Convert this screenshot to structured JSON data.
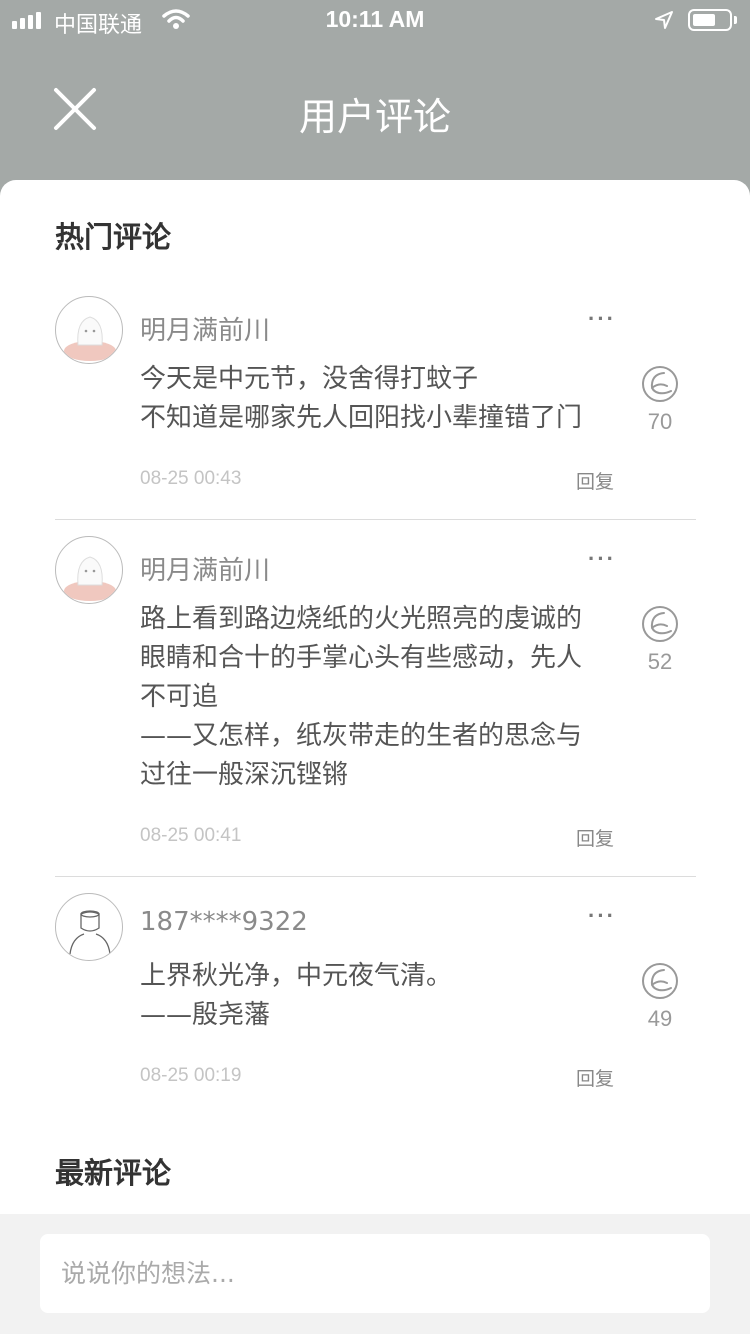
{
  "status_bar": {
    "carrier": "中国联通",
    "time": "10:11 AM",
    "icons": [
      "signal-icon",
      "wifi-icon",
      "location-arrow-icon",
      "battery-icon"
    ]
  },
  "nav": {
    "title": "用户评论",
    "close_icon": "close-icon"
  },
  "sections": {
    "hot_title": "热门评论",
    "latest_title": "最新评论"
  },
  "comments": [
    {
      "username": "明月满前川",
      "lines": [
        "今天是中元节，没舍得打蚊子",
        "不知道是哪家先人回阳找小辈撞错了门"
      ],
      "likes": "70",
      "time": "08-25 00:43",
      "reply": "回复",
      "more": "···"
    },
    {
      "username": "明月满前川",
      "lines": [
        "路上看到路边烧纸的火光照亮的虔诚的",
        "眼睛和合十的手掌心头有些感动，先人",
        "不可追",
        "——又怎样，纸灰带走的生者的思念与",
        "过往一般深沉铿锵"
      ],
      "likes": "52",
      "time": "08-25 00:41",
      "reply": "回复",
      "more": "···"
    },
    {
      "username": "187****9322",
      "lines": [
        "上界秋光净，中元夜气清。",
        "——殷尧藩"
      ],
      "likes": "49",
      "time": "08-25 00:19",
      "reply": "回复",
      "more": "···"
    }
  ],
  "input": {
    "placeholder": "说说你的想法..."
  },
  "colors": {
    "header_bg": "#a4a9a7",
    "username": "#8a8a8a",
    "content": "#555555",
    "timestamp": "#c4c4c4"
  }
}
